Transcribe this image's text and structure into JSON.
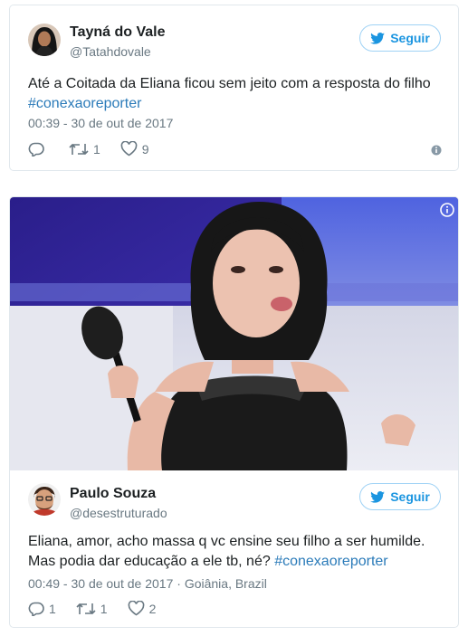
{
  "tweets": [
    {
      "name": "Tayná do Vale",
      "handle": "@Tatahdovale",
      "follow_label": "Seguir",
      "text": "Até a Coitada da Eliana ficou sem jeito com a resposta do filho",
      "hashtag": "#conexaoreporter",
      "timestamp": "00:39 - 30 de out de 2017",
      "replies": "",
      "retweets": "1",
      "likes": "9"
    },
    {
      "name": "Paulo Souza",
      "handle": "@desestruturado",
      "follow_label": "Seguir",
      "text_line1": "Eliana, amor, acho massa q vc ensine seu filho a ser humilde.",
      "text_line2_prefix": "Mas podia dar educação a ele tb, né?",
      "hashtag": "#conexaoreporter",
      "timestamp": "00:49 - 30 de out de 2017",
      "location": "Goiânia, Brazil",
      "replies": "1",
      "retweets": "1",
      "likes": "2"
    }
  ],
  "icons": {
    "follow": "twitter-bird-icon",
    "reply": "reply-icon",
    "retweet": "retweet-icon",
    "like": "heart-icon",
    "info": "info-icon"
  },
  "colors": {
    "link": "#2b7bb9",
    "follow": "#1b95e0",
    "muted": "#697882"
  }
}
